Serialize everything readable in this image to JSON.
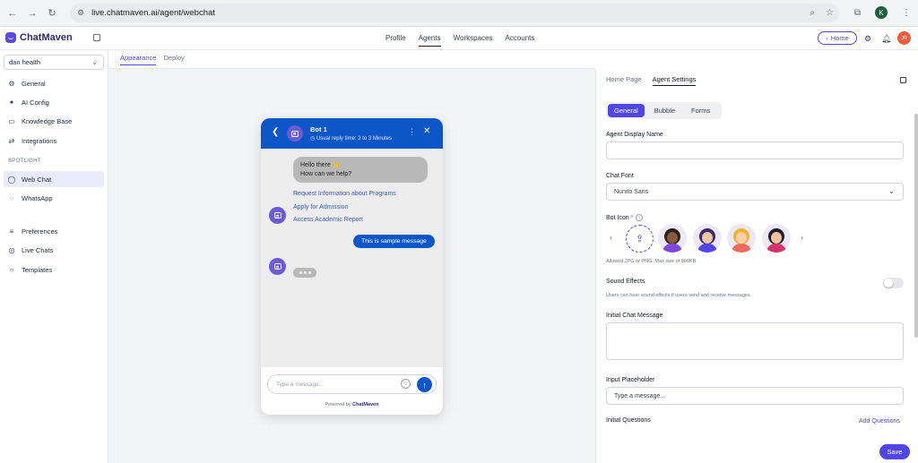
{
  "browser": {
    "url": "live.chatmaven.ai/agent/webchat",
    "profile_initial": "K"
  },
  "app": {
    "logo_text": "ChatMaven",
    "nav": [
      "Profile",
      "Agents",
      "Workspaces",
      "Accounts"
    ],
    "active_nav": "Agents",
    "home_label": "Home",
    "avatar_initials": "JR"
  },
  "sidebar": {
    "workspace": "dan health",
    "items_top": [
      {
        "label": "General",
        "icon": "gear-icon"
      },
      {
        "label": "AI Config",
        "icon": "sparkle-icon"
      },
      {
        "label": "Knowledge Base",
        "icon": "book-icon"
      },
      {
        "label": "Integrations",
        "icon": "sync-icon"
      }
    ],
    "section_label": "SPOTLIGHT",
    "items_spotlight": [
      {
        "label": "Web Chat",
        "icon": "chat-icon",
        "active": true
      },
      {
        "label": "WhatsApp",
        "icon": "whatsapp-icon"
      }
    ],
    "items_bottom": [
      {
        "label": "Preferences",
        "icon": "sliders-icon"
      },
      {
        "label": "Live Chats",
        "icon": "chat-bubble-icon"
      },
      {
        "label": "Templates",
        "icon": "template-icon"
      }
    ]
  },
  "main": {
    "subtabs": [
      "Appearance",
      "Deploy"
    ],
    "active_subtab": "Appearance"
  },
  "widget": {
    "bot_name": "Bot 1",
    "reply_time": "Usual reply time: 2 to 3 Minutes",
    "greeting_line1": "Hello there 👋",
    "greeting_line2": "How can we help?",
    "quick_replies": [
      "Request Information about Programs",
      "Apply for Admission",
      "Access Academic Report"
    ],
    "user_message": "This is sample message",
    "input_placeholder": "Type a message...",
    "powered_prefix": "Powered by",
    "powered_brand": "ChatMaven",
    "header_color": "#0d56c8"
  },
  "panel": {
    "tabs": [
      "Home Page",
      "Agent Settings"
    ],
    "active_tab": "Agent Settings",
    "segments": [
      "General",
      "Bubble",
      "Forms"
    ],
    "active_segment": "General",
    "display_name_label": "Agent Display Name",
    "display_name_value": "",
    "chat_font_label": "Chat Font",
    "chat_font_value": "Nunito Sans",
    "bot_icon_label": "Bot Icon",
    "bot_icon_hint": "Allowed JPG or PNG. Max size of 800KB",
    "sound_label": "Sound Effects",
    "sound_hint": "Users can hear sound effects if users send and receive messages",
    "initial_message_label": "Initial Chat Message",
    "input_placeholder_label": "Input Placeholder",
    "input_placeholder_value": "Type a message...",
    "initial_questions_label": "Initial Questions",
    "add_questions_label": "Add Questions",
    "save_label": "Save",
    "accent_color": "#4f46e5"
  }
}
